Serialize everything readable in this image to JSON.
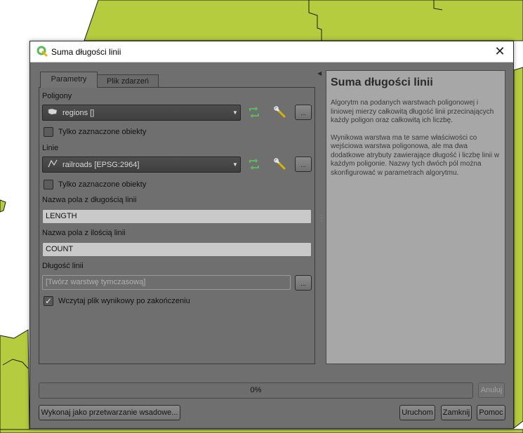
{
  "window": {
    "title": "Suma długości linii"
  },
  "tabs": [
    {
      "label": "Parametry",
      "active": true
    },
    {
      "label": "Plik zdarzeń",
      "active": false
    }
  ],
  "params": {
    "polygons_label": "Poligony",
    "polygons_value": "regions []",
    "polygons_selected_only": "Tylko zaznaczone obiekty",
    "lines_label": "Linie",
    "lines_value": "railroads [EPSG:2964]",
    "lines_selected_only": "Tylko zaznaczone obiekty",
    "length_field_label": "Nazwa pola z długością linii",
    "length_field_value": "LENGTH",
    "count_field_label": "Nazwa pola z ilością linii",
    "count_field_value": "COUNT",
    "output_label": "Długość linii",
    "output_placeholder": "[Twórz warstwę tymczasową]",
    "load_output_label": "Wczytaj plik wynikowy po zakończeniu",
    "load_output_checked": true,
    "browse_label": "..."
  },
  "help": {
    "title": "Suma długości linii",
    "paragraph1": "Algorytm na podanych warstwach poligonowej i liniowej mierzy całkowitą długość linii przecinających każdy poligon oraz całkowitą ich liczbę.",
    "paragraph2": "Wynikowa warstwa ma te same właściwości co wejściowa warstwa poligonowa, ale ma dwa dodatkowe atrybuty zawierające długość i liczbę linii w każdym poligonie. Nazwy tych dwóch pól można skonfigurować w parametrach algorytmu."
  },
  "progress": {
    "text": "0%",
    "value": 0
  },
  "buttons": {
    "cancel": "Anuluj",
    "batch": "Wykonaj jako przetwarzanie wsadowe...",
    "run": "Uruchom",
    "close": "Zamknij",
    "help": "Pomoc"
  },
  "colors": {
    "map_fill": "#b5cc3f",
    "map_stroke": "#1a1a1a",
    "accent_green": "#5cb85c",
    "dialog_bg": "#6f6f6f",
    "help_bg": "#a7a7a7"
  },
  "icons": {
    "app": "qgis-icon",
    "close": "close-icon",
    "polygon_layer": "polygon-layer-icon",
    "line_layer": "line-layer-icon",
    "iterate": "iterate-icon",
    "settings": "wrench-icon"
  }
}
